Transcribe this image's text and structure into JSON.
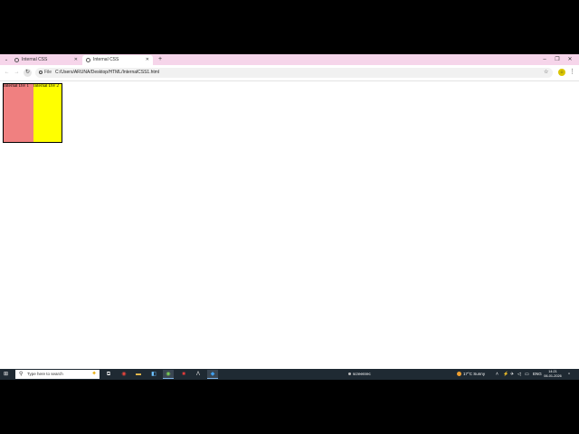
{
  "browser": {
    "tabs": [
      {
        "title": "Internal CSS",
        "active": false
      },
      {
        "title": "Internal CSS",
        "active": true
      }
    ],
    "site_info_label": "File",
    "url": "C:/Users/ARUNA/Desktop/HTML/InternalCSS1.html"
  },
  "page": {
    "div1_text": "Internal Div 1",
    "div1_color": "#f08080",
    "div2_text": "Internal Div 2",
    "div2_color": "#ffff00"
  },
  "taskbar": {
    "search_placeholder": "Type here to search",
    "recording_label": "screenrec",
    "weather": "17°C  Sunny",
    "language": "ENG",
    "time": "14:21",
    "date": "06-01-2026"
  },
  "icons": [
    "tab-search-icon",
    "globe-icon",
    "close-icon",
    "plus-icon",
    "minimize-icon",
    "maximize-icon",
    "back-arrow-icon",
    "forward-arrow-icon",
    "reload-icon",
    "info-icon",
    "star-icon",
    "profile-icon",
    "more-menu-icon",
    "windows-start-icon",
    "search-icon",
    "task-view-icon",
    "chrome-icon",
    "file-explorer-icon",
    "store-icon",
    "wps-icon",
    "vscode-icon"
  ]
}
